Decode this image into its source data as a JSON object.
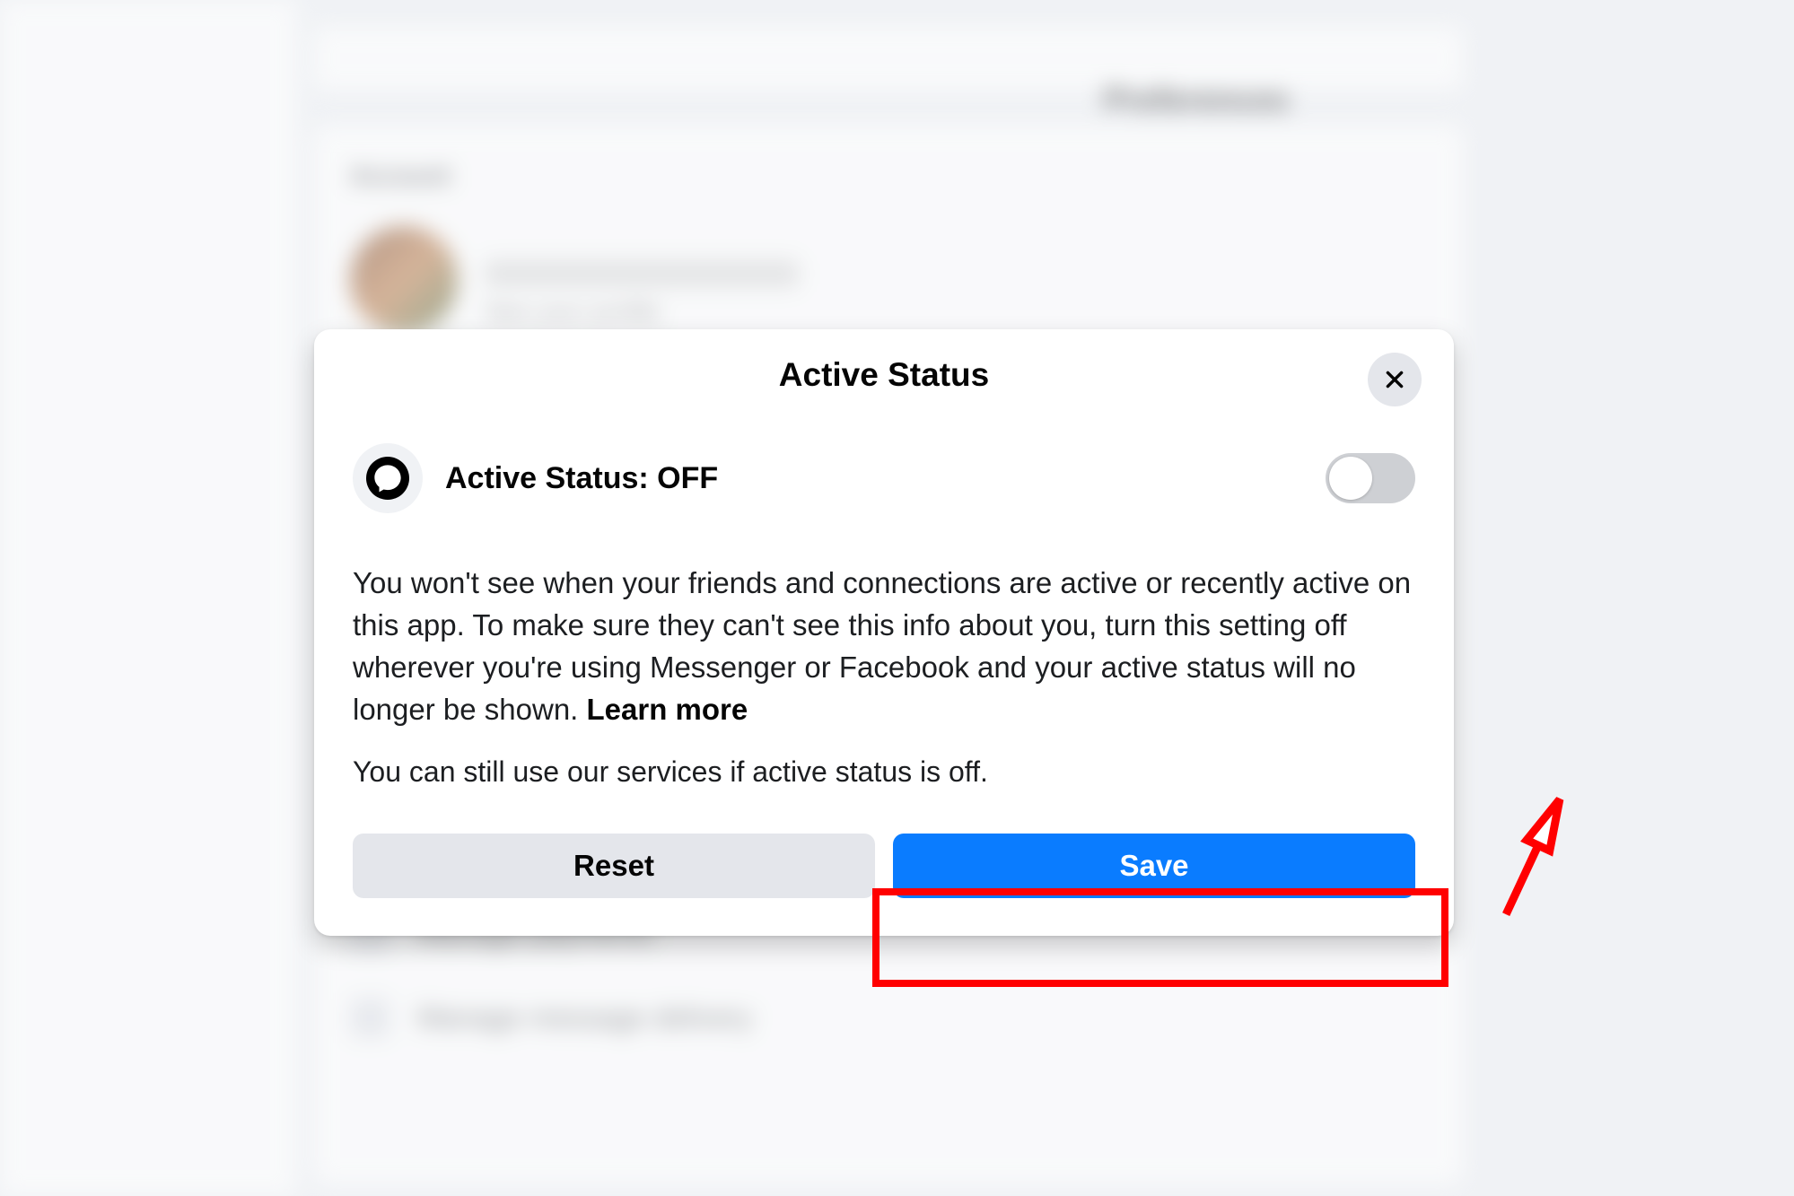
{
  "modal": {
    "title": "Active Status",
    "statusLabel": "Active Status: OFF",
    "description": "You won't see when your friends and connections are active or recently active on this app. To make sure they can't see this info about you, turn this setting off wherever you're using Messenger or Facebook and your active status will no longer be shown. ",
    "learnMore": "Learn more",
    "subDescription": "You can still use our services if active status is off.",
    "resetLabel": "Reset",
    "saveLabel": "Save",
    "toggleState": "off"
  },
  "background": {
    "pageTitle": "Preferences",
    "sectionLabel": "Account",
    "managePaymentsLabel": "Manage payments",
    "manageDeliveryLabel": "Manage message delivery",
    "seeProfileLabel": "See your profile"
  },
  "colors": {
    "saveButton": "#0a7cff",
    "annotation": "#ff0000"
  }
}
